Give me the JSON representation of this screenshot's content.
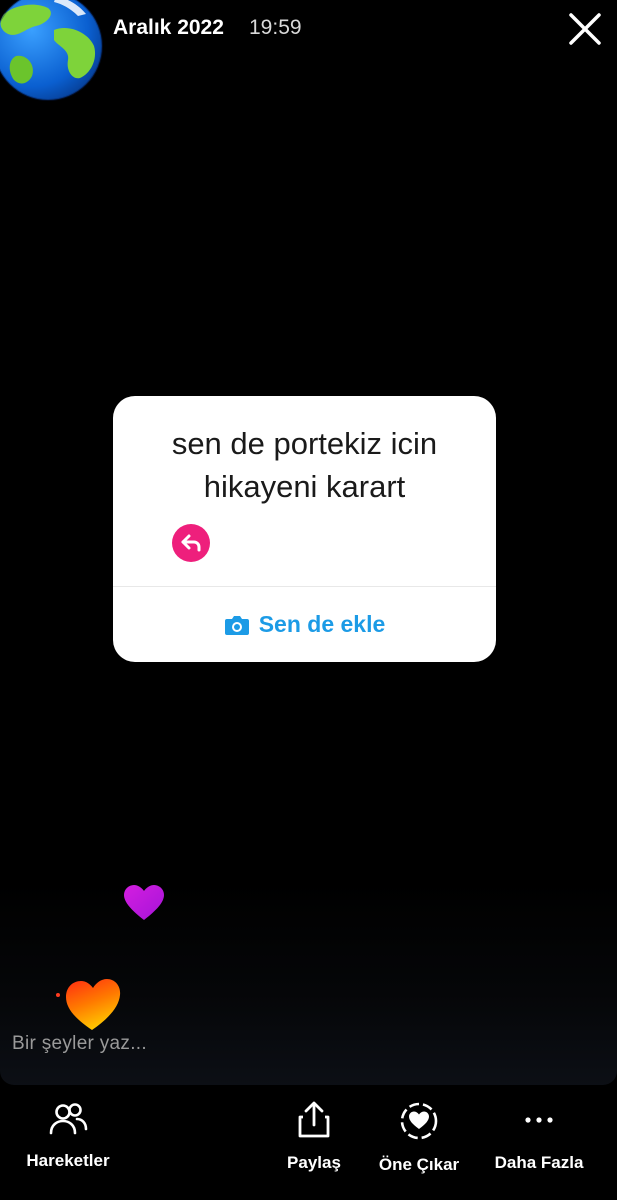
{
  "header": {
    "date": "Aralık 2022",
    "time": "19:59",
    "avatar_icon": "globe-icon",
    "close_icon": "close-icon"
  },
  "question_card": {
    "prompt": "sen de portekiz icin\nhikayeni karart",
    "reply_icon": "reply-arrow-icon",
    "add_button_label": "Sen de ekle",
    "add_button_icon": "camera-icon",
    "accent_color": "#1c9be6",
    "reply_color": "#ee1f7c"
  },
  "reactions": [
    "heart-icon",
    "heart-icon"
  ],
  "reply_input": {
    "placeholder": "Bir şeyler yaz..."
  },
  "bottom_actions": [
    {
      "label": "Hareketler",
      "icon": "people-icon"
    },
    {
      "label": "Paylaş",
      "icon": "share-icon"
    },
    {
      "label": "Öne Çıkar",
      "icon": "highlight-heart-icon"
    },
    {
      "label": "Daha Fazla",
      "icon": "more-dots-icon"
    }
  ]
}
